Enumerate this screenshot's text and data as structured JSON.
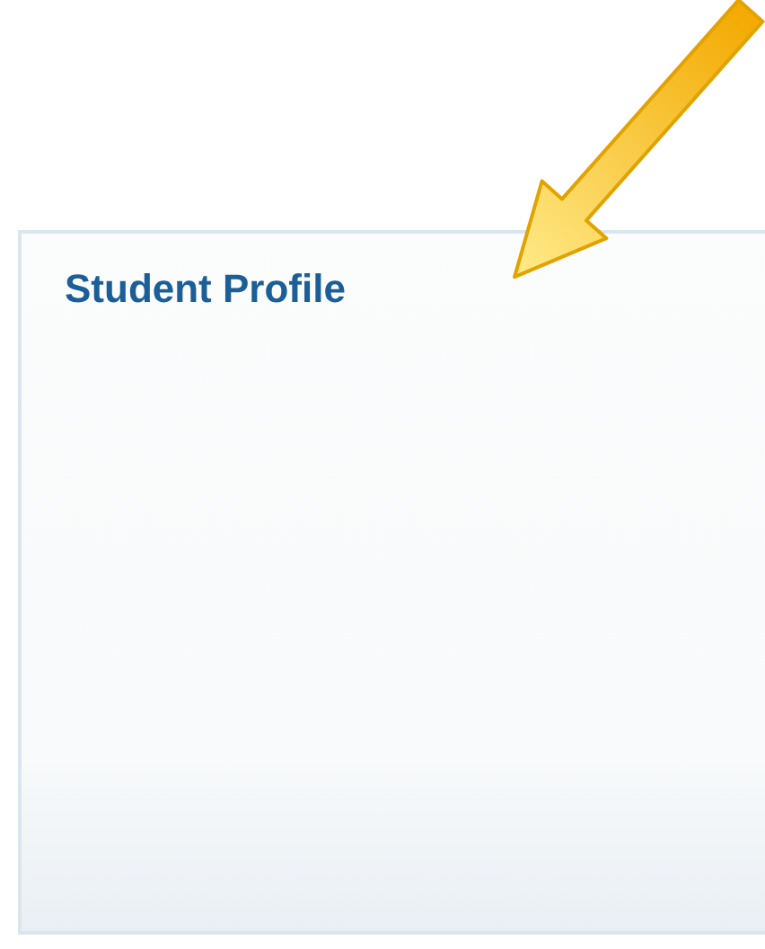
{
  "panel": {
    "title": "Student Profile"
  }
}
